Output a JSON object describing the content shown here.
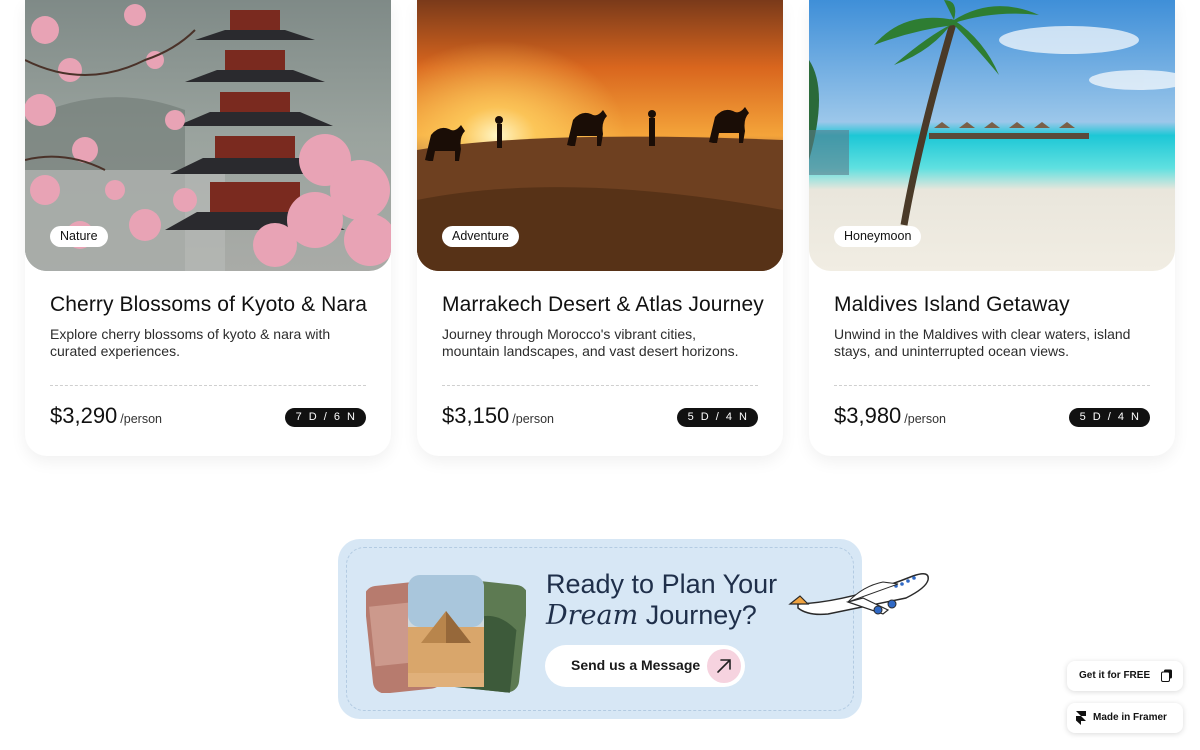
{
  "cards": [
    {
      "tag": "Nature",
      "title": "Cherry Blossoms of Kyoto & Nara",
      "description": "Explore cherry blossoms of kyoto & nara with curated experiences.",
      "price": "$3,290",
      "per": "/person",
      "duration": "7 D / 6 N"
    },
    {
      "tag": "Adventure",
      "title": "Marrakech Desert & Atlas Journey",
      "description": "Journey through Morocco's vibrant cities, mountain landscapes, and vast desert horizons.",
      "price": "$3,150",
      "per": "/person",
      "duration": "5 D / 4 N"
    },
    {
      "tag": "Honeymoon",
      "title": "Maldives Island Getaway",
      "description": "Unwind in the Maldives with clear waters, island stays, and uninterrupted ocean views.",
      "price": "$3,980",
      "per": "/person",
      "duration": "5 D / 4 N"
    }
  ],
  "cta": {
    "heading_line1": "Ready to Plan Your",
    "heading_serif": "Dream",
    "heading_rest": " Journey?",
    "button_label": "Send us a Message"
  },
  "badges": {
    "get_free": "Get it for FREE",
    "made_in": "Made in Framer"
  },
  "icons": {
    "arrow": "arrow-up-right-icon",
    "plane": "airplane-icon",
    "framer": "framer-logo-icon"
  }
}
